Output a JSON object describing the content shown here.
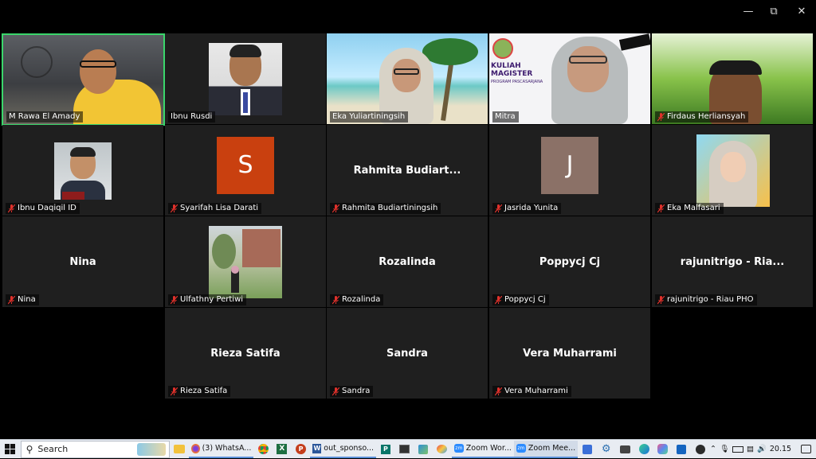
{
  "window": {
    "minimize_icon": "minimize-icon",
    "restore_icon": "restore-icon",
    "close_icon": "close-icon"
  },
  "participants": [
    {
      "display": "M Rawa El Amady",
      "tag": "M Rawa El Amady",
      "kind": "video",
      "muted": false,
      "active": true
    },
    {
      "display": "Ibnu Rusdi",
      "tag": "Ibnu Rusdi",
      "kind": "photo",
      "muted": false
    },
    {
      "display": "Eka Yuliartiningsih",
      "tag": "Eka Yuliartiningsih",
      "kind": "video",
      "muted": false
    },
    {
      "display": "Mitra",
      "tag": "Mitra",
      "kind": "video",
      "muted": false,
      "banner": [
        "KULIAH",
        "MAGISTER",
        "PROGRAM PASCASARJANA"
      ]
    },
    {
      "display": "Firdaus Herliansyah",
      "tag": "Firdaus Herliansyah",
      "kind": "video",
      "muted": true
    },
    {
      "display": "Ibnu Daqiqil ID",
      "tag": "Ibnu Daqiqil ID",
      "kind": "photo",
      "muted": true
    },
    {
      "display": "S",
      "tag": "Syarifah Lisa Darati",
      "kind": "letter",
      "muted": true,
      "color": "#c9400f"
    },
    {
      "display": "Rahmita  Budiart...",
      "tag": "Rahmita Budiartiningsih",
      "kind": "name",
      "muted": true
    },
    {
      "display": "J",
      "tag": "Jasrida Yunita",
      "kind": "letter",
      "muted": true,
      "color": "#8b7167"
    },
    {
      "display": "Eka Malfasari",
      "tag": "Eka Malfasari",
      "kind": "photo",
      "muted": true
    },
    {
      "display": "Nina",
      "tag": "Nina",
      "kind": "name",
      "muted": true
    },
    {
      "display": "Ulfathny Pertiwi",
      "tag": "Ulfathny Pertiwi",
      "kind": "photo",
      "muted": true
    },
    {
      "display": "Rozalinda",
      "tag": "Rozalinda",
      "kind": "name",
      "muted": true
    },
    {
      "display": "Poppycj Cj",
      "tag": "Poppycj Cj",
      "kind": "name",
      "muted": true
    },
    {
      "display": "rajunitrigo  - Ria...",
      "tag": "rajunitrigo - Riau PHO",
      "kind": "name",
      "muted": true
    },
    {
      "display": "Rieza Satifa",
      "tag": "Rieza Satifa",
      "kind": "name",
      "muted": true
    },
    {
      "display": "Sandra",
      "tag": "Sandra",
      "kind": "name",
      "muted": true
    },
    {
      "display": "Vera Muharrami",
      "tag": "Vera Muharrami",
      "kind": "name",
      "muted": true
    }
  ],
  "taskbar": {
    "search_placeholder": "Search",
    "apps": [
      {
        "label": "(3) WhatsA...",
        "icon": "firefox-icon"
      },
      {
        "label": "out_sponso...",
        "icon": "word-icon"
      },
      {
        "label": "Zoom Wor...",
        "icon": "zoom-icon"
      },
      {
        "label": "Zoom Mee...",
        "icon": "zoom-icon"
      }
    ],
    "time": "20.15"
  },
  "colors": {
    "active_border": "#3ad66b",
    "tile_bg": "#1f1f1f",
    "muted_red": "#e0312b"
  }
}
